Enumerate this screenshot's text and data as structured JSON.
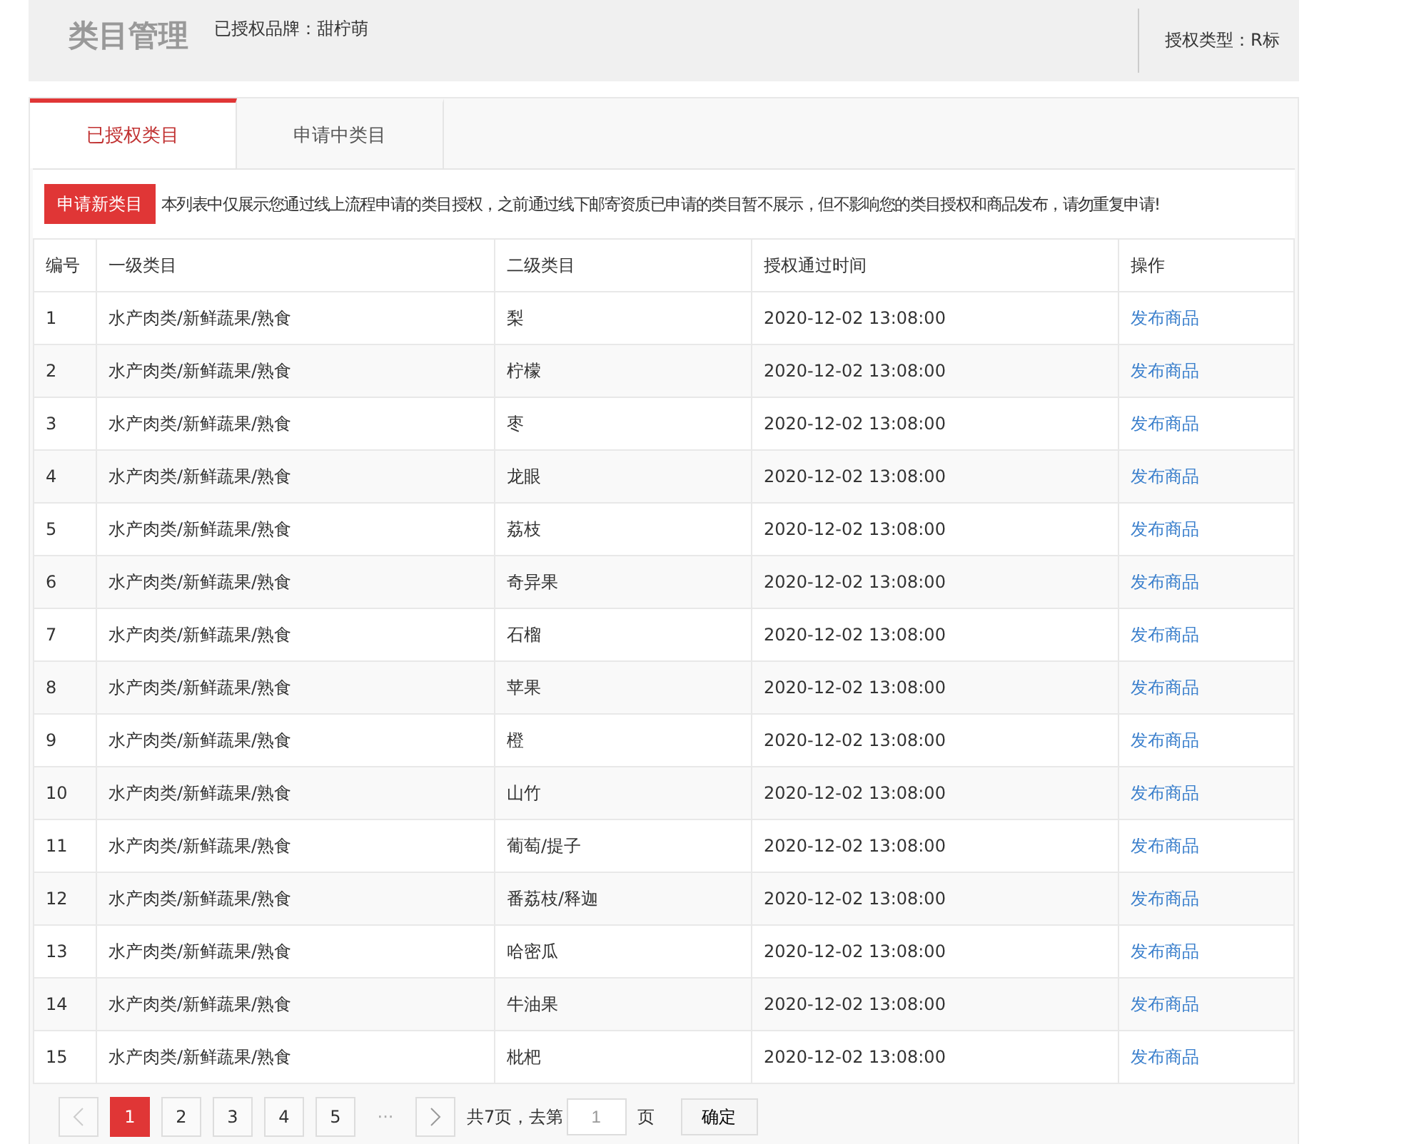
{
  "header": {
    "title": "类目管理",
    "brand": "已授权品牌：甜柠萌",
    "auth_type": "授权类型：R标"
  },
  "tabs": [
    {
      "label": "已授权类目",
      "selected": true
    },
    {
      "label": "申请中类目",
      "selected": false
    }
  ],
  "apply_button": "申请新类目",
  "notice": "本列表中仅展示您通过线上流程申请的类目授权，之前通过线下邮寄资质已申请的类目暂不展示，但不影响您的类目授权和商品发布，请勿重复申请!",
  "table": {
    "columns": [
      "编号",
      "一级类目",
      "二级类目",
      "授权通过时间",
      "操作"
    ],
    "rows": [
      {
        "no": "1",
        "level1": "水产肉类/新鲜蔬果/熟食",
        "level2": "梨",
        "time": "2020-12-02 13:08:00",
        "action": "发布商品"
      },
      {
        "no": "2",
        "level1": "水产肉类/新鲜蔬果/熟食",
        "level2": "柠檬",
        "time": "2020-12-02 13:08:00",
        "action": "发布商品"
      },
      {
        "no": "3",
        "level1": "水产肉类/新鲜蔬果/熟食",
        "level2": "枣",
        "time": "2020-12-02 13:08:00",
        "action": "发布商品"
      },
      {
        "no": "4",
        "level1": "水产肉类/新鲜蔬果/熟食",
        "level2": "龙眼",
        "time": "2020-12-02 13:08:00",
        "action": "发布商品"
      },
      {
        "no": "5",
        "level1": "水产肉类/新鲜蔬果/熟食",
        "level2": "荔枝",
        "time": "2020-12-02 13:08:00",
        "action": "发布商品"
      },
      {
        "no": "6",
        "level1": "水产肉类/新鲜蔬果/熟食",
        "level2": "奇异果",
        "time": "2020-12-02 13:08:00",
        "action": "发布商品"
      },
      {
        "no": "7",
        "level1": "水产肉类/新鲜蔬果/熟食",
        "level2": "石榴",
        "time": "2020-12-02 13:08:00",
        "action": "发布商品"
      },
      {
        "no": "8",
        "level1": "水产肉类/新鲜蔬果/熟食",
        "level2": "苹果",
        "time": "2020-12-02 13:08:00",
        "action": "发布商品"
      },
      {
        "no": "9",
        "level1": "水产肉类/新鲜蔬果/熟食",
        "level2": "橙",
        "time": "2020-12-02 13:08:00",
        "action": "发布商品"
      },
      {
        "no": "10",
        "level1": "水产肉类/新鲜蔬果/熟食",
        "level2": "山竹",
        "time": "2020-12-02 13:08:00",
        "action": "发布商品"
      },
      {
        "no": "11",
        "level1": "水产肉类/新鲜蔬果/熟食",
        "level2": "葡萄/提子",
        "time": "2020-12-02 13:08:00",
        "action": "发布商品"
      },
      {
        "no": "12",
        "level1": "水产肉类/新鲜蔬果/熟食",
        "level2": "番荔枝/释迦",
        "time": "2020-12-02 13:08:00",
        "action": "发布商品"
      },
      {
        "no": "13",
        "level1": "水产肉类/新鲜蔬果/熟食",
        "level2": "哈密瓜",
        "time": "2020-12-02 13:08:00",
        "action": "发布商品"
      },
      {
        "no": "14",
        "level1": "水产肉类/新鲜蔬果/熟食",
        "level2": "牛油果",
        "time": "2020-12-02 13:08:00",
        "action": "发布商品"
      },
      {
        "no": "15",
        "level1": "水产肉类/新鲜蔬果/熟食",
        "level2": "枇杷",
        "time": "2020-12-02 13:08:00",
        "action": "发布商品"
      }
    ]
  },
  "pagination": {
    "pages": [
      {
        "label": "1",
        "selected": true
      },
      {
        "label": "2",
        "selected": false
      },
      {
        "label": "3",
        "selected": false
      },
      {
        "label": "4",
        "selected": false
      },
      {
        "label": "5",
        "selected": false
      }
    ],
    "ellipsis": "···",
    "total": "共7页，去第",
    "page_input": "1",
    "page_suffix": "页",
    "confirm": "确定"
  }
}
